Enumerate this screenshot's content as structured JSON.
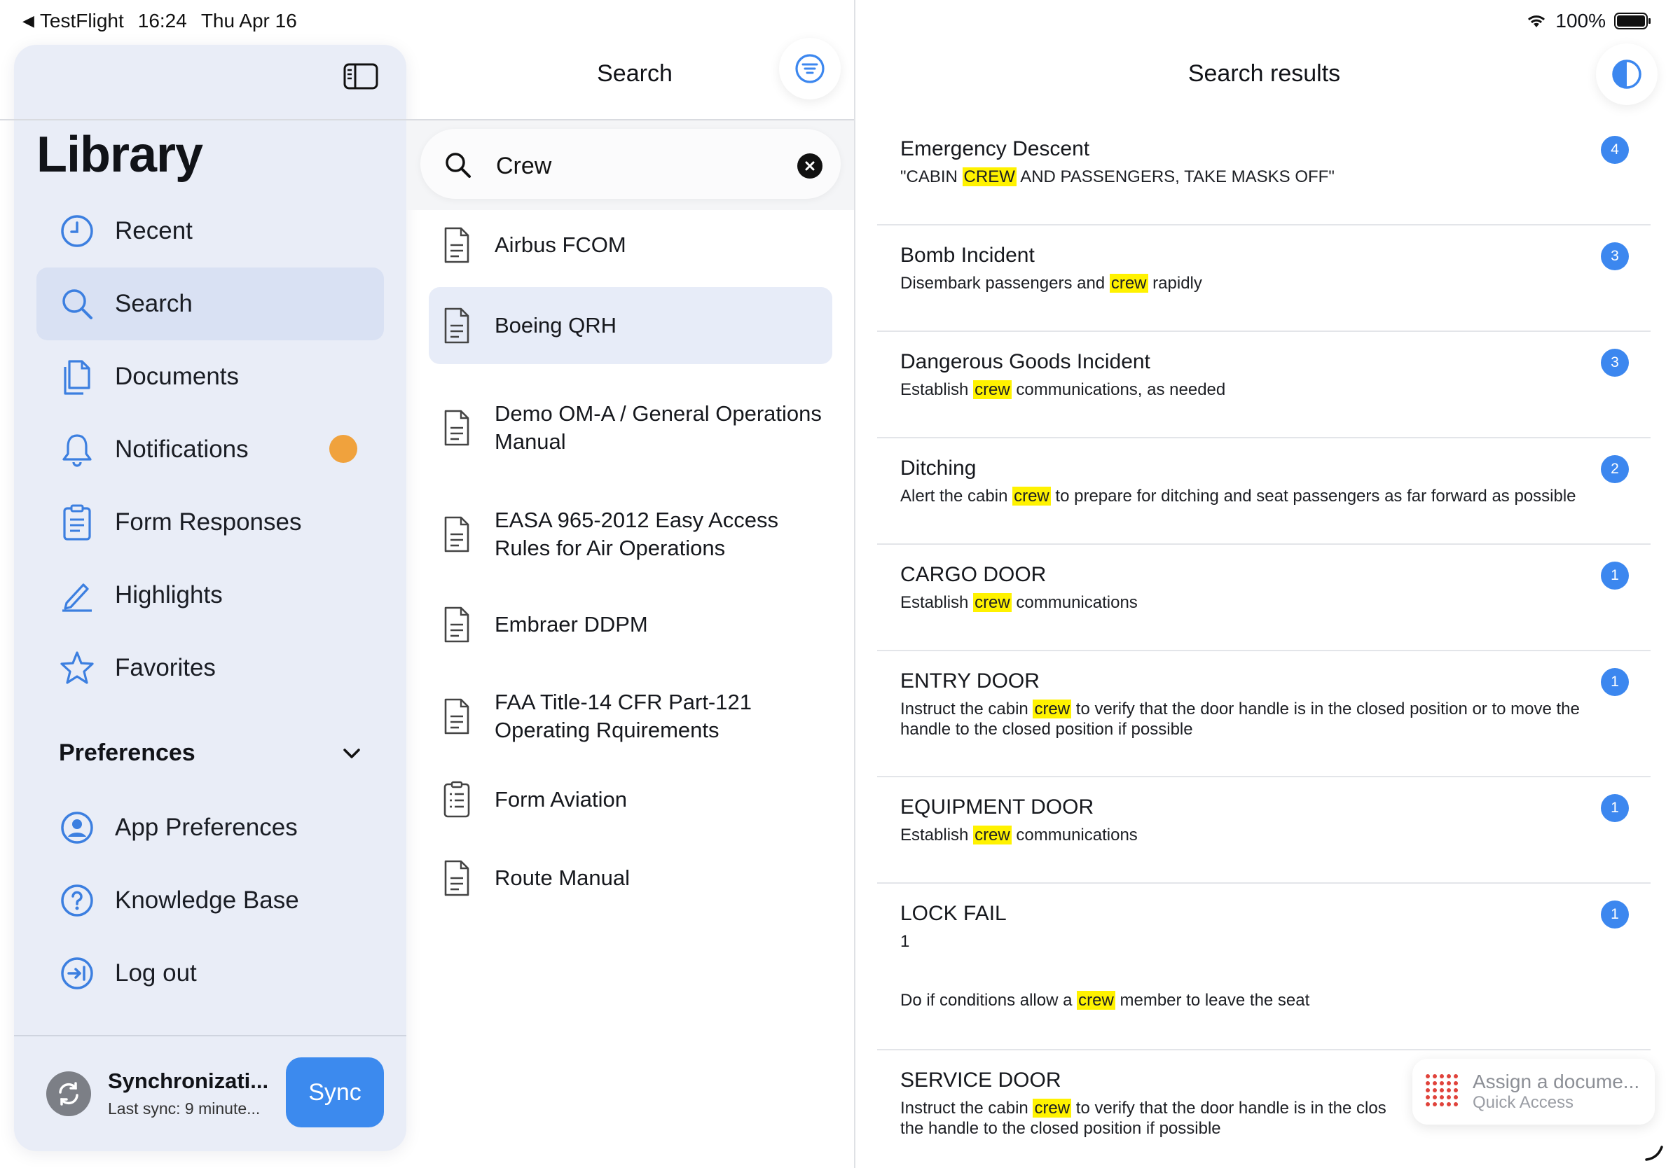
{
  "status_bar": {
    "back_app": "TestFlight",
    "time": "16:24",
    "date": "Thu Apr 16",
    "battery": "100%"
  },
  "sidebar": {
    "title": "Library",
    "items": [
      {
        "label": "Recent",
        "icon": "clock-icon"
      },
      {
        "label": "Search",
        "icon": "search-icon",
        "active": true
      },
      {
        "label": "Documents",
        "icon": "documents-icon"
      },
      {
        "label": "Notifications",
        "icon": "bell-icon",
        "badge": true
      },
      {
        "label": "Form Responses",
        "icon": "clipboard-icon"
      },
      {
        "label": "Highlights",
        "icon": "pen-icon"
      },
      {
        "label": "Favorites",
        "icon": "star-icon"
      }
    ],
    "preferences_title": "Preferences",
    "pref_items": [
      {
        "label": "App Preferences",
        "icon": "person-circle-icon"
      },
      {
        "label": "Knowledge Base",
        "icon": "question-circle-icon"
      },
      {
        "label": "Log out",
        "icon": "logout-icon"
      }
    ],
    "sync": {
      "title": "Synchronizati...",
      "subtitle": "Last sync: 9 minute...",
      "button": "Sync"
    }
  },
  "search_panel": {
    "title": "Search",
    "query": "Crew",
    "documents": [
      {
        "label": "Airbus FCOM"
      },
      {
        "label": "Boeing QRH",
        "active": true
      },
      {
        "label": "Demo OM-A / General Operations Manual"
      },
      {
        "label": "EASA 965-2012 Easy Access Rules for Air Operations"
      },
      {
        "label": "Embraer DDPM"
      },
      {
        "label": "FAA Title-14 CFR Part-121 Operating Rquirements"
      },
      {
        "label": "Form Aviation",
        "icon": "form-icon"
      },
      {
        "label": "Route Manual"
      }
    ]
  },
  "results_panel": {
    "title": "Search results",
    "results": [
      {
        "title": "Emergency Descent",
        "count": "4",
        "pre": "\"CABIN ",
        "hit": "CREW",
        "post": " AND PASSENGERS, TAKE MASKS OFF\""
      },
      {
        "title": "Bomb Incident",
        "count": "3",
        "pre": "Disembark passengers and ",
        "hit": "crew",
        "post": " rapidly"
      },
      {
        "title": "Dangerous Goods Incident",
        "count": "3",
        "pre": "Establish ",
        "hit": "crew",
        "post": " communications, as needed"
      },
      {
        "title": "Ditching",
        "count": "2",
        "pre": "Alert the cabin ",
        "hit": "crew",
        "post": " to prepare for ditching and seat passengers as far forward as possible"
      },
      {
        "title": "CARGO DOOR",
        "count": "1",
        "pre": "Establish ",
        "hit": "crew",
        "post": " communications"
      },
      {
        "title": "ENTRY DOOR",
        "count": "1",
        "pre": "Instruct the cabin ",
        "hit": "crew",
        "post": " to verify that the door handle is in the closed position or to move the handle to the closed position if possible"
      },
      {
        "title": "EQUIPMENT DOOR",
        "count": "1",
        "pre": "Establish ",
        "hit": "crew",
        "post": " communications"
      },
      {
        "title": "LOCK FAIL",
        "count": "1",
        "extra": "1",
        "pre": "Do if conditions allow a ",
        "hit": "crew",
        "post": " member to leave the seat"
      },
      {
        "title": "SERVICE DOOR",
        "pre": "Instruct the cabin ",
        "hit": "crew",
        "post": " to verify that the door handle is in the clos",
        "line2": "the handle to the closed position if possible"
      }
    ]
  },
  "quick_access": {
    "line1": "Assign a docume...",
    "line2": "Quick Access"
  },
  "colors": {
    "accent": "#3c8aee",
    "badge": "#f0a23d",
    "highlight": "#fff200",
    "sidebar_bg": "#e9edf7"
  }
}
